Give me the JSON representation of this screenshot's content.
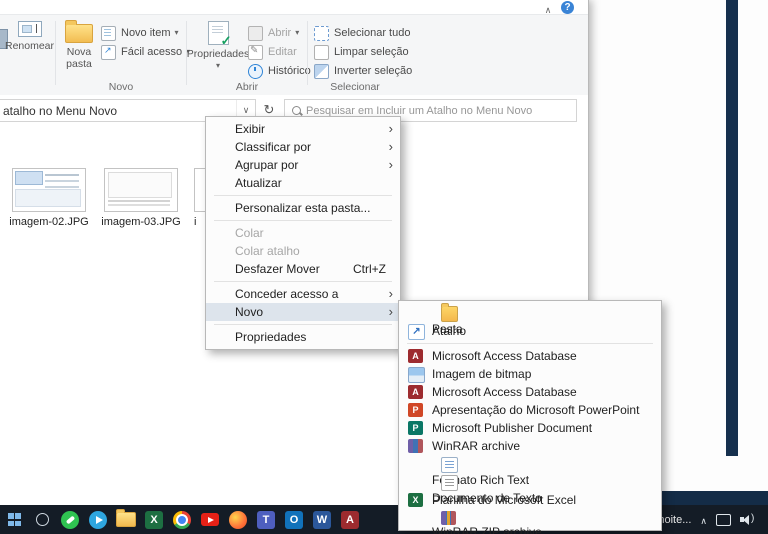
{
  "window_chrome": {
    "help_glyph": "?"
  },
  "ribbon": {
    "rename_label": "Renomear",
    "new_folder_label": "Nova pasta",
    "new_item_label": "Novo item",
    "easy_access_label": "Fácil acesso",
    "group_new_label": "Novo",
    "properties_label": "Propriedades",
    "open_label": "Abrir",
    "edit_label": "Editar",
    "history_label": "Histórico",
    "group_open_label": "Abrir",
    "select_all_label": "Selecionar tudo",
    "clear_selection_label": "Limpar seleção",
    "invert_selection_label": "Inverter seleção",
    "group_select_label": "Selecionar"
  },
  "address_bar": {
    "path_text": "atalho no Menu Novo",
    "search_placeholder": "Pesquisar em Incluir um Atalho no Menu Novo"
  },
  "files": [
    {
      "name": "imagem-02.JPG"
    },
    {
      "name": "imagem-03.JPG"
    },
    {
      "name": "i"
    }
  ],
  "context_menu": {
    "items": [
      {
        "label": "Exibir",
        "has_submenu": true
      },
      {
        "label": "Classificar por",
        "has_submenu": true
      },
      {
        "label": "Agrupar por",
        "has_submenu": true
      },
      {
        "label": "Atualizar"
      },
      {
        "label": "Personalizar esta pasta..."
      },
      {
        "label": "Colar",
        "disabled": true
      },
      {
        "label": "Colar atalho",
        "disabled": true
      },
      {
        "label": "Desfazer Mover",
        "shortcut": "Ctrl+Z"
      },
      {
        "label": "Conceder acesso a",
        "has_submenu": true
      },
      {
        "label": "Novo",
        "has_submenu": true,
        "highlighted": true
      },
      {
        "label": "Propriedades"
      }
    ]
  },
  "new_submenu": {
    "items": [
      {
        "label": "Pasta",
        "icon": "folder-icon"
      },
      {
        "label": "Atalho",
        "icon": "shortcut-icon"
      },
      {
        "label": "Microsoft Access Database",
        "icon": "access-icon"
      },
      {
        "label": "Imagem de bitmap",
        "icon": "bitmap-icon"
      },
      {
        "label": "Microsoft Access Database",
        "icon": "access-icon"
      },
      {
        "label": "Apresentação do Microsoft PowerPoint",
        "icon": "powerpoint-icon"
      },
      {
        "label": "Microsoft Publisher Document",
        "icon": "publisher-icon"
      },
      {
        "label": "WinRAR archive",
        "icon": "winrar-icon"
      },
      {
        "label": "Formato Rich Text",
        "icon": "richtext-icon"
      },
      {
        "label": "Documento de Texto",
        "icon": "textdoc-icon"
      },
      {
        "label": "Planilha do Microsoft Excel",
        "icon": "excel-icon"
      },
      {
        "label": "WinRAR ZIP archive",
        "icon": "zip-icon"
      }
    ]
  },
  "taskbar": {
    "tray_text": "noite...",
    "icons": [
      "start",
      "search",
      "whatsapp",
      "telegram",
      "file-explorer",
      "excel",
      "chrome",
      "youtube",
      "firefox",
      "teams",
      "outlook",
      "word",
      "access"
    ]
  },
  "colors": {
    "desktop_bg": "#142c47",
    "taskbar_bg": "#141c26",
    "ribbon_bg": "#f5f6f7",
    "menu_highlight": "#dde4ec",
    "help_blue": "#3a84d6",
    "folder_yellow": "#f6c453"
  }
}
